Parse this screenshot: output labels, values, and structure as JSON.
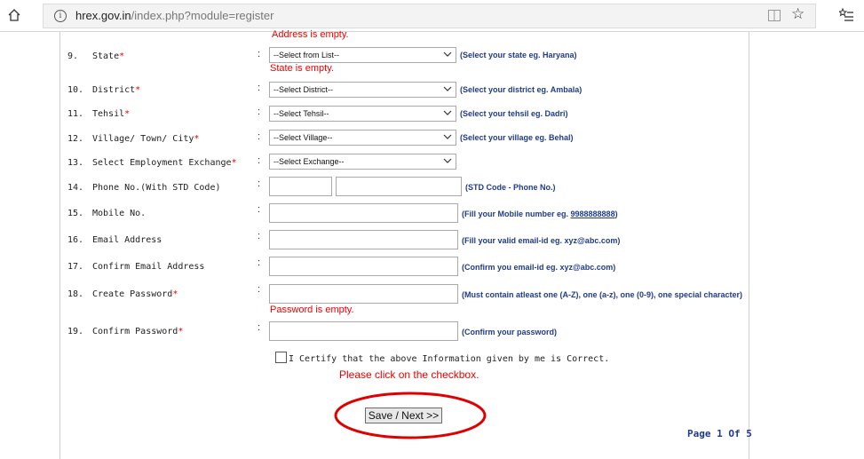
{
  "browser": {
    "url_host": "hrex.gov.in",
    "url_path": "/index.php?module=register"
  },
  "form": {
    "top_error": "Address is empty.",
    "colon": ":",
    "fields": [
      {
        "num": "9.",
        "label": "State",
        "required": "*",
        "type": "select",
        "value": "--Select from List--",
        "hint": "(Select your state eg. Haryana)",
        "error": "State is empty."
      },
      {
        "num": "10.",
        "label": "District",
        "required": "*",
        "type": "select",
        "value": "--Select District--",
        "hint": "(Select your district eg. Ambala)"
      },
      {
        "num": "11.",
        "label": "Tehsil",
        "required": "*",
        "type": "select",
        "value": "--Select Tehsil--",
        "hint": "(Select your tehsil eg. Dadri)"
      },
      {
        "num": "12.",
        "label": "Village/ Town/ City",
        "required": "*",
        "type": "select",
        "value": "--Select Village--",
        "hint": "(Select your village eg. Behal)"
      },
      {
        "num": "13.",
        "label": "Select Employment Exchange",
        "required": "*",
        "type": "select",
        "value": "--Select Exchange--",
        "hint": ""
      },
      {
        "num": "14.",
        "label": "Phone No.(With STD Code)",
        "required": "",
        "type": "phone",
        "hint": "(STD Code - Phone No.)"
      },
      {
        "num": "15.",
        "label": "Mobile No.",
        "required": "",
        "type": "text",
        "hint_prefix": "(Fill your Mobile number eg. ",
        "hint_link": "9988888888",
        "hint_suffix": ")"
      },
      {
        "num": "16.",
        "label": "Email Address",
        "required": "",
        "type": "text",
        "hint": "(Fill your valid email-id eg. xyz@abc.com)"
      },
      {
        "num": "17.",
        "label": "Confirm Email Address",
        "required": "",
        "type": "text",
        "hint": "(Confirm you email-id eg. xyz@abc.com)"
      },
      {
        "num": "18.",
        "label": "Create Password",
        "required": "*",
        "type": "password",
        "hint": "(Must contain atleast one (A-Z), one (a-z), one (0-9), one special character)",
        "error": "Password is empty."
      },
      {
        "num": "19.",
        "label": "Confirm Password",
        "required": "*",
        "type": "password",
        "hint": "(Confirm your password)"
      }
    ],
    "certify_text": "I Certify that the above Information given by me is Correct.",
    "certify_error": "Please click on the checkbox.",
    "save_label": "Save / Next >>",
    "page_indicator": "Page 1 Of 5"
  },
  "colors": {
    "error": "#e00000",
    "hint": "#1f3b8c",
    "annotation": "#e00000"
  }
}
